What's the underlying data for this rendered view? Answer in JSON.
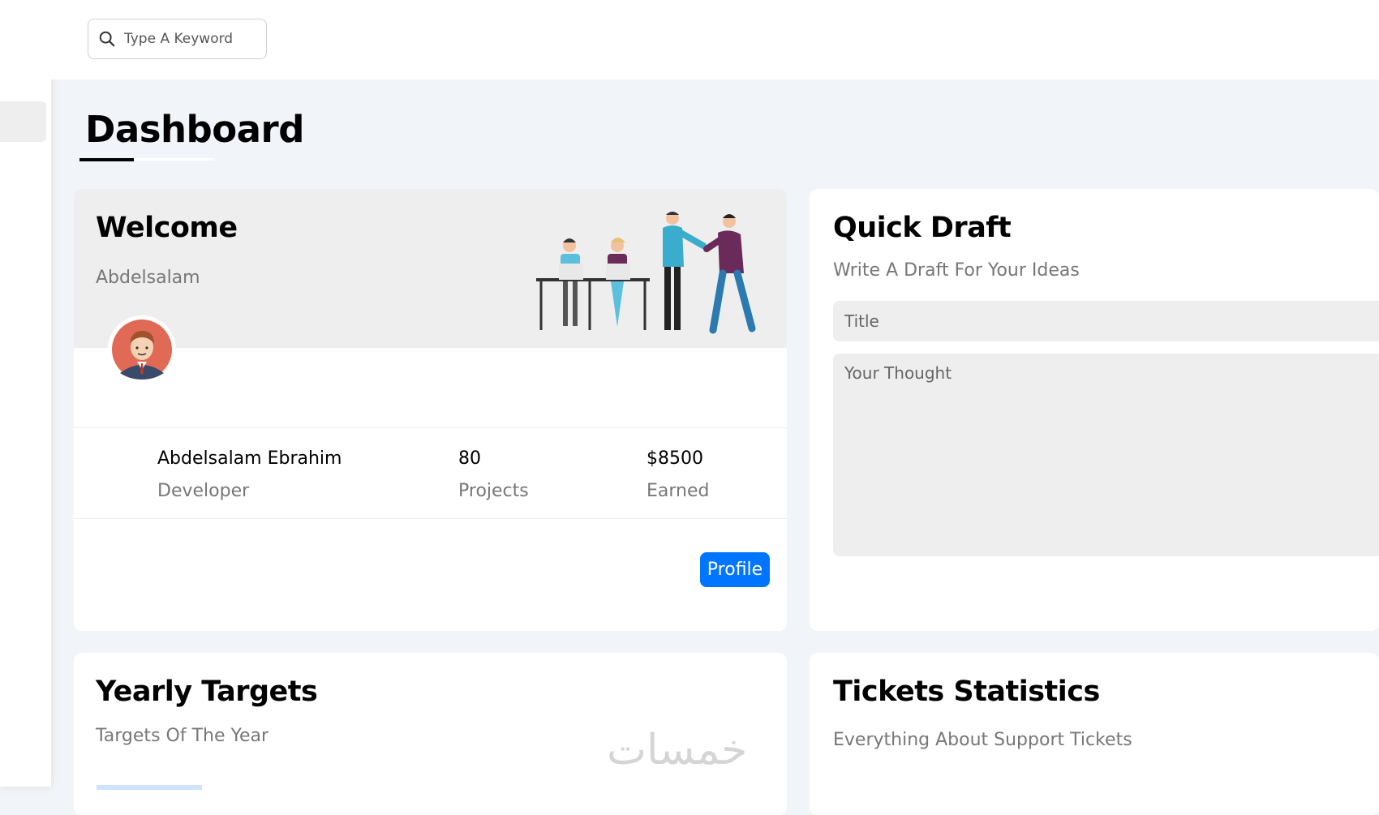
{
  "search": {
    "placeholder": "Type A Keyword"
  },
  "page": {
    "title": "Dashboard"
  },
  "welcome": {
    "title": "Welcome",
    "user_first": "Abdelsalam",
    "name": "Abdelsalam Ebrahim",
    "role": "Developer",
    "projects_value": "80",
    "projects_label": "Projects",
    "earned_value": "$8500",
    "earned_label": "Earned",
    "profile_button": "Profile"
  },
  "quick_draft": {
    "title": "Quick Draft",
    "subtitle": "Write A Draft For Your Ideas",
    "title_placeholder": "Title",
    "thought_placeholder": "Your Thought"
  },
  "yearly_targets": {
    "title": "Yearly Targets",
    "subtitle": "Targets Of The Year"
  },
  "tickets": {
    "title": "Tickets Statistics",
    "subtitle": "Everything About Support Tickets"
  },
  "watermark": "خمسات",
  "colors": {
    "accent": "#0075ff",
    "background": "#f1f5f9",
    "card": "#ffffff",
    "muted": "#777777"
  }
}
